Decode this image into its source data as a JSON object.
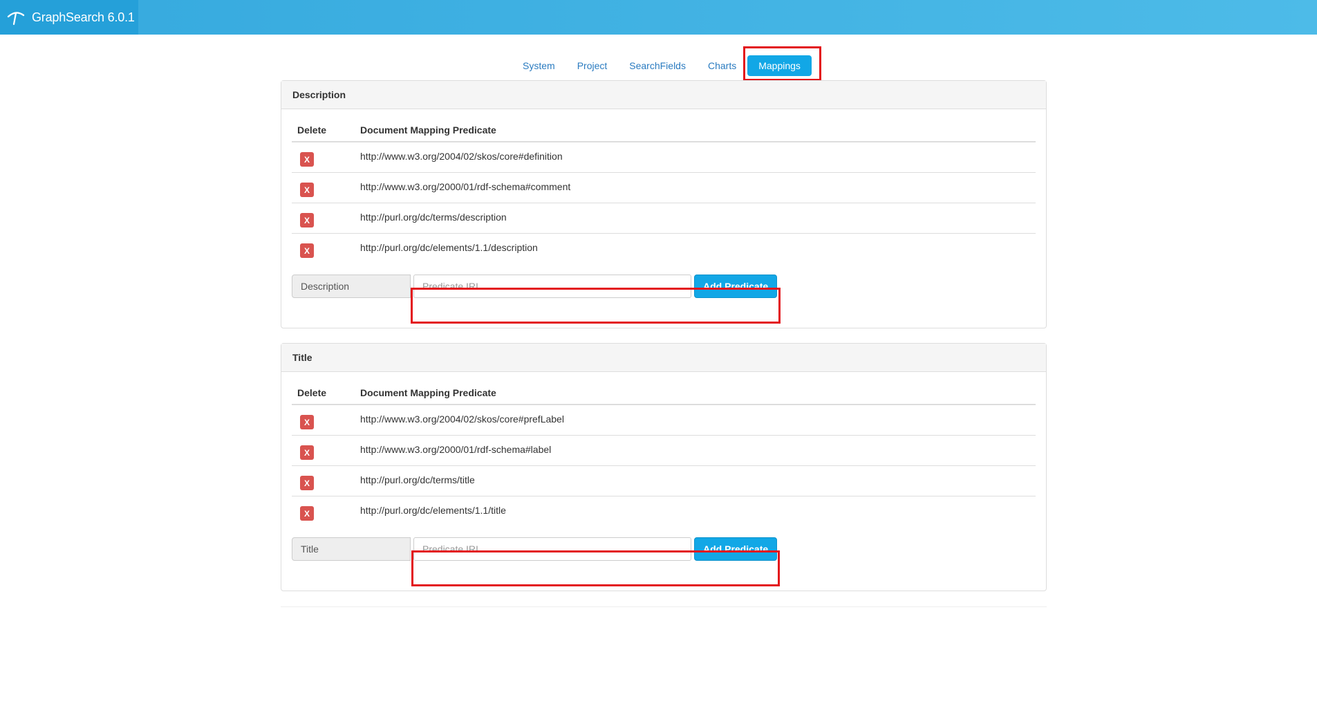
{
  "app": {
    "title": "GraphSearch 6.0.1"
  },
  "tabs": [
    {
      "label": "System"
    },
    {
      "label": "Project"
    },
    {
      "label": "SearchFields"
    },
    {
      "label": "Charts"
    },
    {
      "label": "Mappings",
      "active": true
    }
  ],
  "colors": {
    "accent": "#12a7e6",
    "delete": "#d9534f",
    "highlight": "#e3141a"
  },
  "table_headers": {
    "delete": "Delete",
    "predicate": "Document Mapping Predicate"
  },
  "panels": [
    {
      "heading": "Description",
      "rows": [
        {
          "delete_label": "X",
          "predicate": "http://www.w3.org/2004/02/skos/core#definition"
        },
        {
          "delete_label": "X",
          "predicate": "http://www.w3.org/2000/01/rdf-schema#comment"
        },
        {
          "delete_label": "X",
          "predicate": "http://purl.org/dc/terms/description"
        },
        {
          "delete_label": "X",
          "predicate": "http://purl.org/dc/elements/1.1/description"
        }
      ],
      "field_label": "Description",
      "input_placeholder": "Predicate IRI",
      "input_value": "",
      "button_label": "Add Predicate"
    },
    {
      "heading": "Title",
      "rows": [
        {
          "delete_label": "X",
          "predicate": "http://www.w3.org/2004/02/skos/core#prefLabel"
        },
        {
          "delete_label": "X",
          "predicate": "http://www.w3.org/2000/01/rdf-schema#label"
        },
        {
          "delete_label": "X",
          "predicate": "http://purl.org/dc/terms/title"
        },
        {
          "delete_label": "X",
          "predicate": "http://purl.org/dc/elements/1.1/title"
        }
      ],
      "field_label": "Title",
      "input_placeholder": "Predicate IRI",
      "input_value": "",
      "button_label": "Add Predicate"
    }
  ]
}
